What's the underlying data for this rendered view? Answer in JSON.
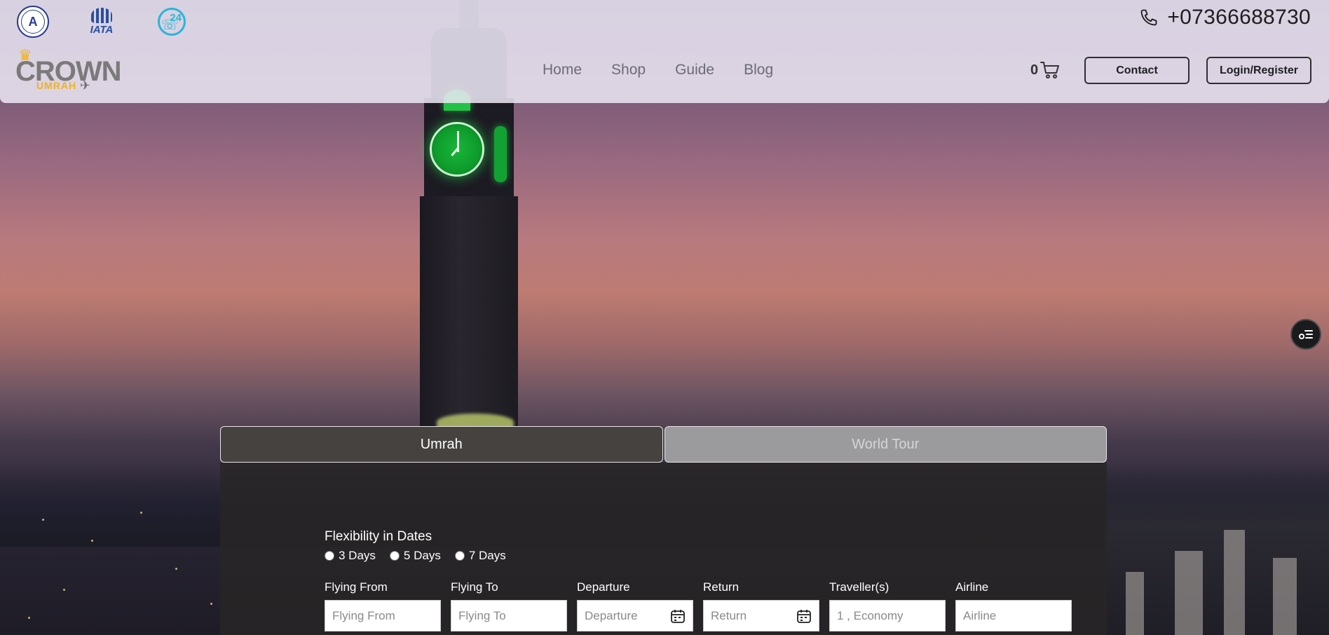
{
  "header": {
    "phone": "+07366688730",
    "nav": [
      "Home",
      "Shop",
      "Guide",
      "Blog"
    ],
    "cart_count": "0",
    "contact_label": "Contact",
    "login_label": "Login/Register",
    "logo": {
      "word": "CROWN",
      "sub": "UMRAH"
    },
    "badges": {
      "iata": "IATA",
      "support": "24"
    }
  },
  "search": {
    "tabs": [
      {
        "label": "Umrah",
        "active": true
      },
      {
        "label": "World Tour",
        "active": false
      }
    ],
    "flex_title": "Flexibility in Dates",
    "flex_options": [
      "3 Days",
      "5 Days",
      "7 Days"
    ],
    "fields": [
      {
        "label": "Flying From",
        "placeholder": "Flying From"
      },
      {
        "label": "Flying To",
        "placeholder": "Flying To"
      },
      {
        "label": "Departure",
        "placeholder": "Departure"
      },
      {
        "label": "Return",
        "placeholder": "Return"
      },
      {
        "label": "Traveller(s)",
        "placeholder": "1 , Economy"
      },
      {
        "label": "Airline",
        "placeholder": "Airline"
      }
    ]
  },
  "colors": {
    "accent_gold": "#f0b21c",
    "active_tab": "#45423f",
    "inactive_tab": "#9b9a9d"
  },
  "icons": [
    "phone-icon",
    "cart-icon",
    "calendar-icon",
    "filter-icon"
  ]
}
